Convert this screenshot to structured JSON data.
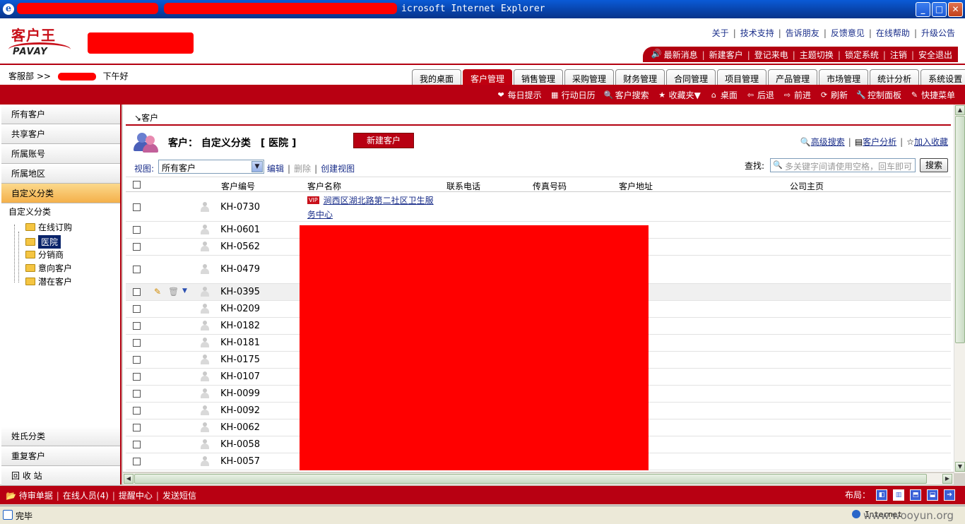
{
  "window": {
    "title_suffix": "icrosoft Internet Explorer",
    "minimize": "_",
    "maximize": "□",
    "close": "✕"
  },
  "logo": {
    "cn": "客户王",
    "en": "PAVAY"
  },
  "top_links": [
    "关于",
    "技术支持",
    "告诉朋友",
    "反馈意见",
    "在线帮助",
    "升级公告"
  ],
  "quick_links": [
    "最新消息",
    "新建客户",
    "登记来电",
    "主题切换",
    "锁定系统",
    "注销",
    "安全退出"
  ],
  "breadcrumb": {
    "dept": "客服部 >>",
    "greeting": "下午好"
  },
  "tabs": [
    "我的桌面",
    "客户管理",
    "销售管理",
    "采购管理",
    "财务管理",
    "合同管理",
    "项目管理",
    "产品管理",
    "市场管理",
    "统计分析",
    "系统设置"
  ],
  "active_tab": "客户管理",
  "toolbar": [
    {
      "label": "每日提示",
      "icon": "heart-icon"
    },
    {
      "label": "行动日历",
      "icon": "calendar-icon"
    },
    {
      "label": "客户搜索",
      "icon": "search-doc-icon"
    },
    {
      "label": "收藏夹▼",
      "icon": "folder-star-icon"
    },
    {
      "label": "桌面",
      "icon": "home-icon"
    },
    {
      "label": "后退",
      "icon": "arrow-left-icon"
    },
    {
      "label": "前进",
      "icon": "arrow-right-icon"
    },
    {
      "label": "刷新",
      "icon": "refresh-icon"
    },
    {
      "label": "控制面板",
      "icon": "wrench-icon"
    },
    {
      "label": "快捷菜单",
      "icon": "edit-icon"
    }
  ],
  "sidebar": {
    "top_items": [
      "所有客户",
      "共享客户",
      "所属账号",
      "所属地区",
      "自定义分类"
    ],
    "active": "自定义分类",
    "tree": {
      "root": "自定义分类",
      "node": "在线订购",
      "children": [
        "医院",
        "分销商",
        "意向客户",
        "潜在客户"
      ],
      "selected": "医院"
    },
    "bottom_items": [
      "姓氏分类",
      "重复客户",
      "回 收 站"
    ]
  },
  "main": {
    "crumb": "客户",
    "title": "客户： 自定义分类　[ 医院 ]",
    "new_button": "新建客户",
    "head_links": [
      "高级搜索",
      "客户分析",
      "加入收藏"
    ],
    "view_label": "视图:",
    "view_value": "所有客户",
    "view_links": {
      "edit": "编辑",
      "delete": "删除",
      "create": "创建视图"
    },
    "find_label": "查找:",
    "find_placeholder": "多关键字间请使用空格，回车即可",
    "find_button": "搜索",
    "columns": [
      "客户编号",
      "客户名称",
      "联系电话",
      "传真号码",
      "客户地址",
      "公司主页"
    ],
    "rows": [
      {
        "code": "KH-0730",
        "name": "涧西区湖北路第二社区卫生服务中心",
        "vip": "VIP"
      },
      {
        "code": "KH-0601"
      },
      {
        "code": "KH-0562"
      },
      {
        "code": "KH-0479"
      },
      {
        "code": "KH-0395"
      },
      {
        "code": "KH-0209"
      },
      {
        "code": "KH-0182"
      },
      {
        "code": "KH-0181"
      },
      {
        "code": "KH-0175"
      },
      {
        "code": "KH-0107"
      },
      {
        "code": "KH-0099"
      },
      {
        "code": "KH-0092"
      },
      {
        "code": "KH-0062"
      },
      {
        "code": "KH-0058"
      },
      {
        "code": "KH-0057"
      }
    ]
  },
  "bottom": {
    "left": [
      "待审单据",
      "在线人员(4)",
      "提醒中心",
      "发送短信"
    ],
    "layout_label": "布局："
  },
  "status": {
    "text": "完毕",
    "zone": "Internet"
  },
  "watermark": "www.wooyun.org",
  "colors": {
    "brand_red": "#b80012",
    "link_blue": "#1a2e8a",
    "active_side": "#f4b04a",
    "redaction": "#ff0000"
  }
}
